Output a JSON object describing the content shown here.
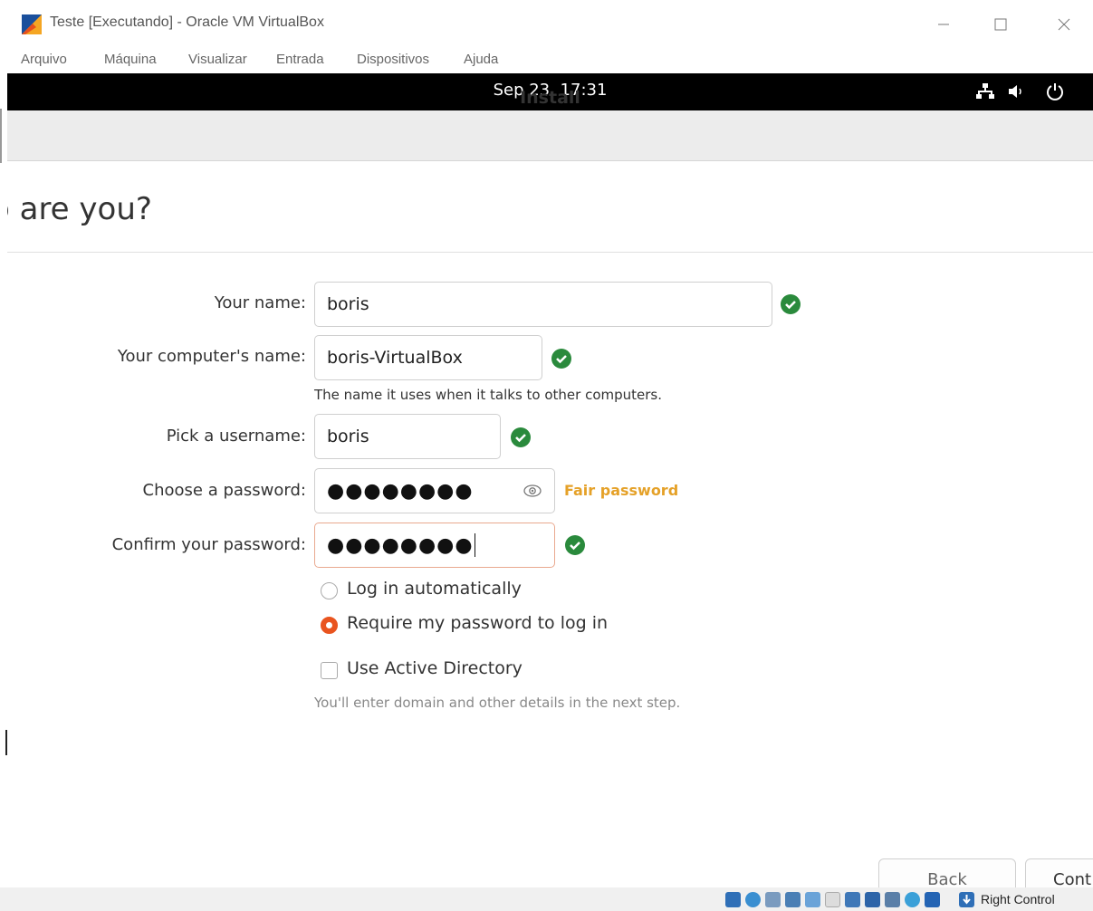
{
  "window": {
    "title": "Teste [Executando] - Oracle VM VirtualBox",
    "menu": [
      "Arquivo",
      "Máquina",
      "Visualizar",
      "Entrada",
      "Dispositivos",
      "Ajuda"
    ],
    "host_key": "Right Control"
  },
  "guest": {
    "clock": "Sep 23  17:31",
    "header_title": "Install",
    "page_heading": "o are you?",
    "form": {
      "name_label": "Your name:",
      "name_value": "boris",
      "computer_label": "Your computer's name:",
      "computer_value": "boris-VirtualBox",
      "computer_hint": "The name it uses when it talks to other computers.",
      "username_label": "Pick a username:",
      "username_value": "boris",
      "password_label": "Choose a password:",
      "password_value": "●●●●●●●●",
      "password_strength": "Fair password",
      "confirm_label": "Confirm your password:",
      "confirm_value": "●●●●●●●●",
      "login_auto": "Log in automatically",
      "login_require": "Require my password to log in",
      "active_directory": "Use Active Directory",
      "ad_hint": "You'll enter domain and other details in the next step."
    },
    "buttons": {
      "back": "Back",
      "continue": "Cont"
    }
  },
  "colors": {
    "accent": "#e9541f",
    "valid": "#2a8a3c",
    "warning": "#e5a128",
    "topbar": "#000000"
  },
  "icons": [
    "virtualbox-logo-icon",
    "network-icon",
    "volume-icon",
    "power-icon",
    "check-icon",
    "eye-icon"
  ]
}
